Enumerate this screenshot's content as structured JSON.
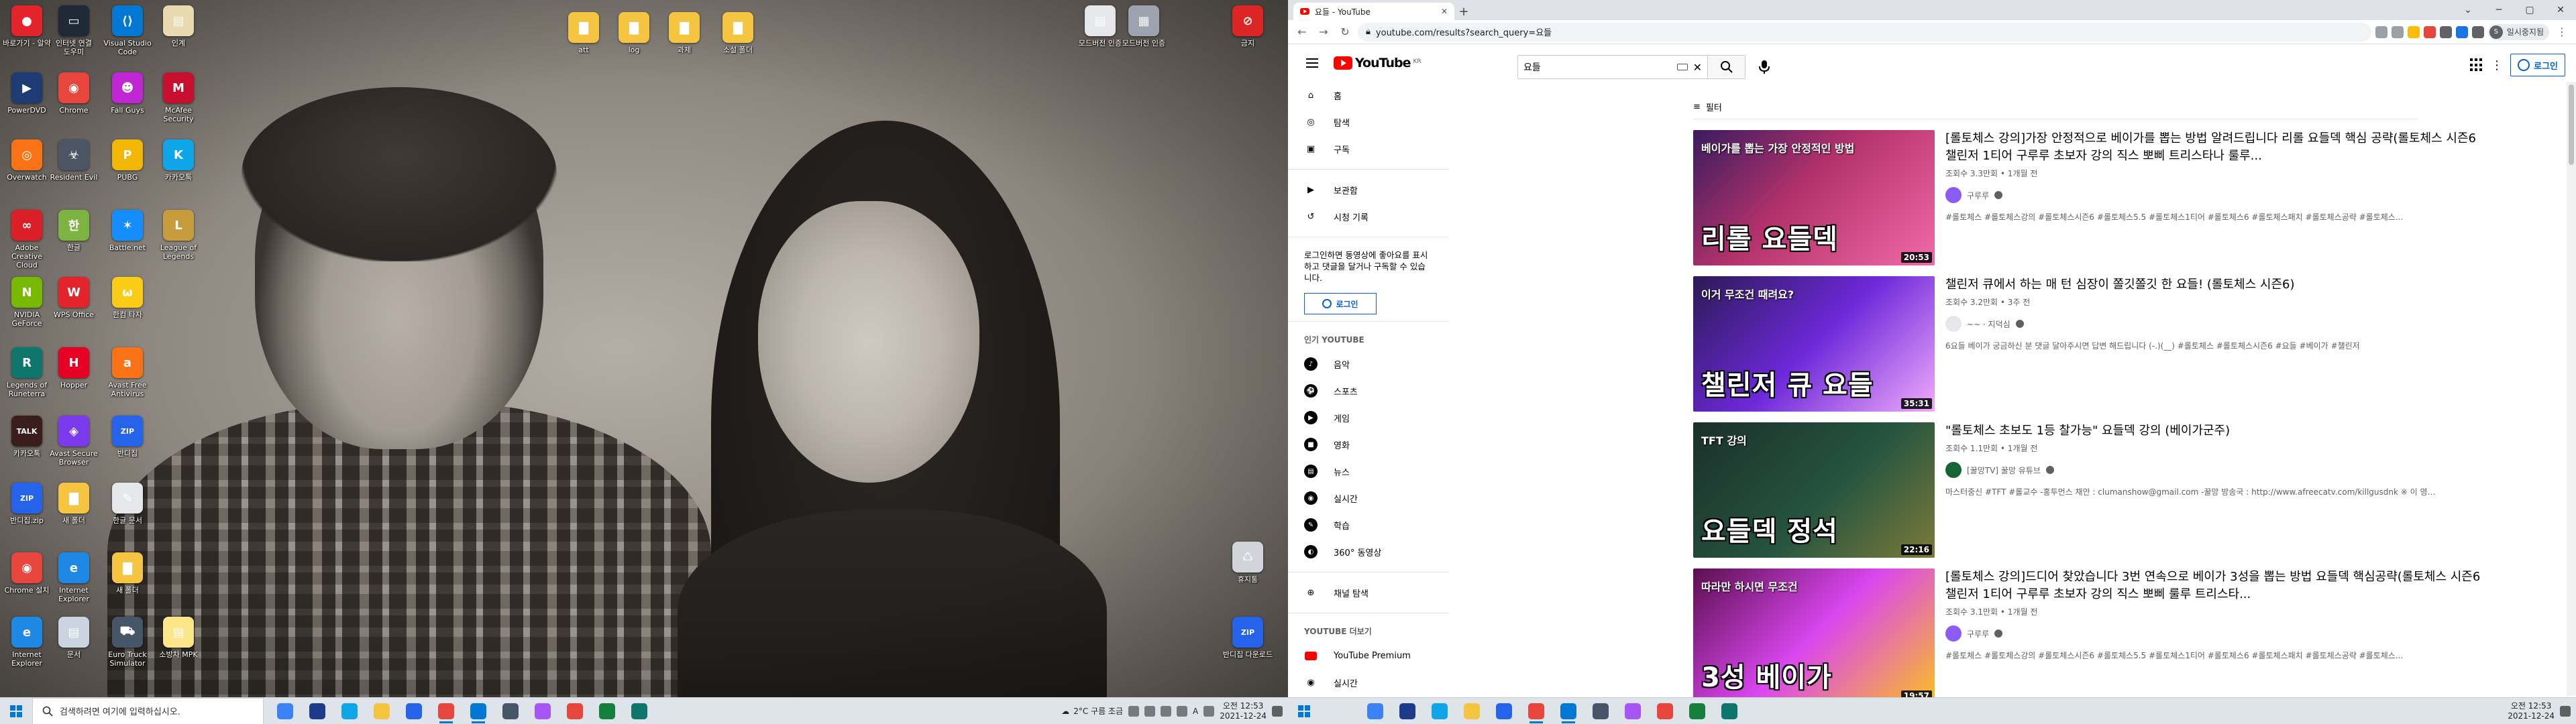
{
  "left": {
    "desktop_icons": [
      {
        "label": "바로가기 - 알약",
        "color": "#e3242b",
        "glyph": "●"
      },
      {
        "label": "인터넷 연결 도우미",
        "color": "#1f2937",
        "glyph": "▭"
      },
      {
        "label": "Visual Studio Code",
        "color": "#0078d4",
        "glyph": "⟨⟩"
      },
      {
        "label": "인계",
        "color": "#e8d9b0",
        "glyph": "▤"
      },
      {
        "label": "PowerDVD",
        "color": "#1f3b73",
        "glyph": "▶"
      },
      {
        "label": "Chrome",
        "color": "#e8453c",
        "glyph": "◉"
      },
      {
        "label": "Fall Guys",
        "color": "#c026d3",
        "glyph": "☻"
      },
      {
        "label": "McAfee Security",
        "color": "#c8102e",
        "glyph": "M"
      },
      {
        "label": "Overwatch",
        "color": "#f97316",
        "glyph": "◎"
      },
      {
        "label": "Resident Evil",
        "color": "#4b5563",
        "glyph": "☣"
      },
      {
        "label": "PUBG",
        "color": "#f2b705",
        "glyph": "P"
      },
      {
        "label": "카카오톡",
        "color": "#0ea5e9",
        "glyph": "K"
      },
      {
        "label": "Adobe Creative Cloud",
        "color": "#da1f26",
        "glyph": "∞"
      },
      {
        "label": "한글",
        "color": "#7cb342",
        "glyph": "한"
      },
      {
        "label": "Battle.net",
        "color": "#148eff",
        "glyph": "✶"
      },
      {
        "label": "League of Legends",
        "color": "#c89b3c",
        "glyph": "L"
      },
      {
        "label": "NVIDIA GeForce",
        "color": "#76b900",
        "glyph": "N"
      },
      {
        "label": "WPS Office",
        "color": "#e3242b",
        "glyph": "W"
      },
      {
        "label": "한컴 타자",
        "color": "#facc15",
        "glyph": "ω"
      },
      {
        "label": "Legends of Runeterra",
        "color": "#0f766e",
        "glyph": "R"
      },
      {
        "label": "Hopper",
        "color": "#e60023",
        "glyph": "H"
      },
      {
        "label": "Avast Free Antivirus",
        "color": "#f97316",
        "glyph": "a"
      },
      {
        "label": "카카오톡",
        "color": "#3a1d1d",
        "glyph": "TALK"
      },
      {
        "label": "Avast Secure Browser",
        "color": "#7c3aed",
        "glyph": "◈"
      },
      {
        "label": "반디집",
        "color": "#2563eb",
        "glyph": "ZIP"
      },
      {
        "label": "반디집.zip",
        "color": "#2563eb",
        "glyph": "ZIP"
      },
      {
        "label": "새 폴더",
        "color": "#f5c542",
        "glyph": "▇"
      },
      {
        "label": "한글 문서",
        "color": "#e5e7eb",
        "glyph": "✎"
      },
      {
        "label": "Chrome 설치",
        "color": "#e8453c",
        "glyph": "◉"
      },
      {
        "label": "Internet Explorer",
        "color": "#1e88e5",
        "glyph": "e"
      },
      {
        "label": "새 폴더",
        "color": "#f5c542",
        "glyph": "▇"
      },
      {
        "label": "Internet Explorer",
        "color": "#1e88e5",
        "glyph": "e"
      },
      {
        "label": "문서",
        "color": "#cbd5e1",
        "glyph": "▤"
      },
      {
        "label": "Euro Truck Simulator",
        "color": "#475569",
        "glyph": "⛟"
      },
      {
        "label": "소방차 MPK",
        "color": "#fde68a",
        "glyph": "▤"
      },
      {
        "label": "att",
        "color": "#f5c542",
        "glyph": "▇"
      },
      {
        "label": "log",
        "color": "#f5c542",
        "glyph": "▇"
      },
      {
        "label": "과제",
        "color": "#f5c542",
        "glyph": "▇"
      },
      {
        "label": "소설 폴더",
        "color": "#f5c542",
        "glyph": "▇"
      },
      {
        "label": "모드버전 인증",
        "color": "#e5e7eb",
        "glyph": "▤"
      },
      {
        "label": "모드버전 인증",
        "color": "#9ca3af",
        "glyph": "▦"
      },
      {
        "label": "금지",
        "color": "#dc2626",
        "glyph": "⊘"
      },
      {
        "label": "휴지통",
        "color": "#d1d5db",
        "glyph": "♺"
      },
      {
        "label": "반디집 다운로드",
        "color": "#2563eb",
        "glyph": "ZIP"
      }
    ],
    "taskbar": {
      "search_placeholder": "검색하려면 여기에 입력하십시오.",
      "weather": "2°C 구름 조금",
      "lang": "A",
      "time": "오전 12:53",
      "date": "2021-12-24",
      "apps": [
        {
          "name": "task-view",
          "color": "#3b82f6"
        },
        {
          "name": "cortana",
          "color": "#1e3a8a"
        },
        {
          "name": "edge",
          "color": "#0ea5e9"
        },
        {
          "name": "file-explorer",
          "color": "#f5c542"
        },
        {
          "name": "mail",
          "color": "#2563eb"
        },
        {
          "name": "chrome",
          "color": "#e8453c"
        },
        {
          "name": "vscode",
          "color": "#0078d4"
        },
        {
          "name": "screen",
          "color": "#475569"
        },
        {
          "name": "game",
          "color": "#a855f7"
        },
        {
          "name": "chrome2",
          "color": "#e8453c"
        },
        {
          "name": "app",
          "color": "#15803d"
        },
        {
          "name": "app2",
          "color": "#0f766e"
        }
      ]
    }
  },
  "browser": {
    "tab_title": "요들 - YouTube",
    "new_tab": "+",
    "url": "youtube.com/results?search_query=요들",
    "profile_label": "일시중지됨",
    "profile_initial": "S"
  },
  "youtube": {
    "logo_word": "YouTube",
    "region": "KR",
    "search_query": "요들",
    "login_label": "로그인",
    "filter_label": "필터",
    "sidebar": {
      "main": [
        {
          "label": "홈",
          "icon": "home-icon",
          "glyph": "⌂"
        },
        {
          "label": "탐색",
          "icon": "explore-icon",
          "glyph": "◎"
        },
        {
          "label": "구독",
          "icon": "subscriptions-icon",
          "glyph": "▣"
        }
      ],
      "lib": [
        {
          "label": "보관함",
          "icon": "library-icon",
          "glyph": "▶"
        },
        {
          "label": "시청 기록",
          "icon": "history-icon",
          "glyph": "↺"
        }
      ],
      "promo_text": "로그인하면 동영상에 좋아요를 표시하고 댓글을 달거나 구독할 수 있습니다.",
      "promo_button": "로그인",
      "popular_heading": "인기 YOUTUBE",
      "popular": [
        {
          "label": "음악",
          "glyph": "♪"
        },
        {
          "label": "스포츠",
          "glyph": "⚽"
        },
        {
          "label": "게임",
          "glyph": "▶"
        },
        {
          "label": "영화",
          "glyph": "■"
        },
        {
          "label": "뉴스",
          "glyph": "▤"
        },
        {
          "label": "실시간",
          "glyph": "◉"
        },
        {
          "label": "학습",
          "glyph": "✎"
        },
        {
          "label": "360° 동영상",
          "glyph": "◐"
        }
      ],
      "browse_channels": "채널 탐색",
      "more_heading": "YOUTUBE 더보기",
      "premium": "YouTube Premium",
      "next_item": "실시간"
    },
    "results": [
      {
        "title": "[롤토체스 강의]가장 안정적으로 베이가를 뽑는 방법 알려드립니다 리롤 요들덱 핵심 공략(롤토체스 시즌6 챌린저 1티어 구루루 초보자 강의 직스 뽀삐 트리스타나 룰루...",
        "meta": "조회수 3.3만회 • 1개월 전",
        "channel": "구루루",
        "desc": "#롤토체스 #롤토체스강의 #롤토체스시즌6 #롤토체스5.5 #롤토체스1티어 #롤토체스6 #롤토체스패치 #롤토체스공략 #롤토체스...",
        "duration": "20:53",
        "big_text": "리롤 요들덱",
        "small_text": "베이가를 뽑는 가장 안정적인 방법",
        "bg": "linear-gradient(135deg,#3a1b5e 0%,#b4326b 45%,#f06aa8 100%)",
        "avatar": "#8b5cf6"
      },
      {
        "title": "챌린저 큐에서 하는 매 턴 심장이 쫄깃쫄깃 한 요들! (롤토체스 시즌6)",
        "meta": "조회수 3.2만회 • 3주 전",
        "channel": "~~ · 지덕심",
        "desc": "6요들 베이가 궁금하신 분 댓글 달아주시면 답변 해드립니다 (-.)(__) #롤토체스 #롤토체스시즌6 #요들 #베이가 #챌린저",
        "duration": "35:31",
        "big_text": "챌린저 큐 요들",
        "small_text": "이거 무조건 때려요?",
        "bg": "linear-gradient(135deg,#2b1a55 0%,#6d28d9 50%,#f0abfc 100%)",
        "avatar": "#e5e7eb"
      },
      {
        "title": "\"롤토체스 초보도 1등 찰가능\" 요들덱 강의 (베이가군주)",
        "meta": "조회수 1.1만회 • 1개월 전",
        "channel": "[꿀망TV] 꿀망 유튜브",
        "desc": "마스터중신 #TFT #롤교수 -홍투먼스 채안 : clumanshow@gmail.com -꿀망 방송국 : http://www.afreecatv.com/killgusdnk ※ 이 영상...",
        "duration": "22:16",
        "big_text": "요들덱 정석",
        "small_text": "TFT 강의",
        "bg": "linear-gradient(135deg,#1c2f2a 0%,#24543f 55%,#7c7a3a 100%)",
        "avatar": "#166534"
      },
      {
        "title": "[롤토체스 강의]드디어 찾았습니다 3번 연속으로 베이가 3성을 뽑는 방법 요들덱 핵심공략(롤토체스 시즌6 챌린저 1티어 구루루 초보자 강의 직스 뽀삐 룰루 트리스타...",
        "meta": "조회수 3.1만회 • 1개월 전",
        "channel": "구루루",
        "desc": "#롤토체스 #롤토체스강의 #롤토체스시즌6 #롤토체스5.5 #롤토체스1티어 #롤토체스6 #롤토체스패치 #롤토체스공략 #롤토체스...",
        "duration": "19:57",
        "big_text": "3성 베이가",
        "small_text": "따라만 하시면 무조건",
        "bg": "linear-gradient(135deg,#5b0f4f 0%,#d946ef 50%,#fbbf24 100%)",
        "avatar": "#8b5cf6"
      }
    ]
  },
  "right_taskbar": {
    "time": "오전 12:53",
    "date": "2021-12-24"
  }
}
